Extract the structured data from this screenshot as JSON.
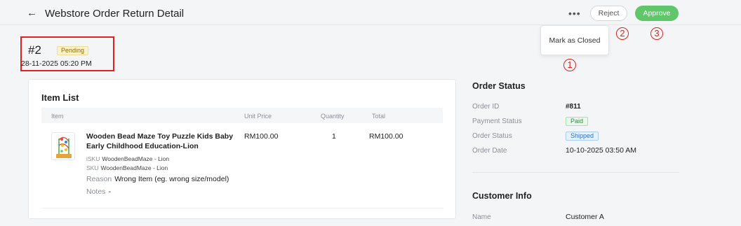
{
  "header": {
    "back_icon": "arrow-left-icon",
    "back_glyph": "←",
    "title": "Webstore Order Return Detail",
    "more_glyph": "•••",
    "reject_label": "Reject",
    "approve_label": "Approve"
  },
  "dropdown": {
    "item_label": "Mark as Closed"
  },
  "callouts": [
    "1",
    "2",
    "3"
  ],
  "order": {
    "number": "#2",
    "status_badge": "Pending",
    "datetime": "28-11-2025 05:20 PM"
  },
  "item_list": {
    "title": "Item List",
    "columns": [
      "Item",
      "Unit Price",
      "Quantity",
      "Total"
    ],
    "rows": [
      {
        "product_name": "Wooden Bead Maze Toy Puzzle Kids Baby Early Childhood Education-Lion",
        "isku_label": "iSKU",
        "isku": "WoodenBeadMaze - Lion",
        "sku_label": "SKU",
        "sku": "WoodenBeadMaze - Lion",
        "reason_label": "Reason",
        "reason": "Wrong Item (eg. wrong size/model)",
        "notes_label": "Notes",
        "notes": "-",
        "unit_price": "RM100.00",
        "quantity": "1",
        "total": "RM100.00"
      }
    ]
  },
  "order_status": {
    "title": "Order Status",
    "order_id_label": "Order ID",
    "order_id": "#811",
    "payment_status_label": "Payment Status",
    "payment_status": "Paid",
    "order_status_label": "Order Status",
    "order_status": "Shipped",
    "order_date_label": "Order Date",
    "order_date": "10-10-2025 03:50 AM"
  },
  "customer_info": {
    "title": "Customer Info",
    "name_label": "Name",
    "name": "Customer A"
  },
  "colors": {
    "accent_green": "#5fc66a",
    "annotation_red": "#e0211f",
    "pending_bg": "#fff2c8"
  }
}
